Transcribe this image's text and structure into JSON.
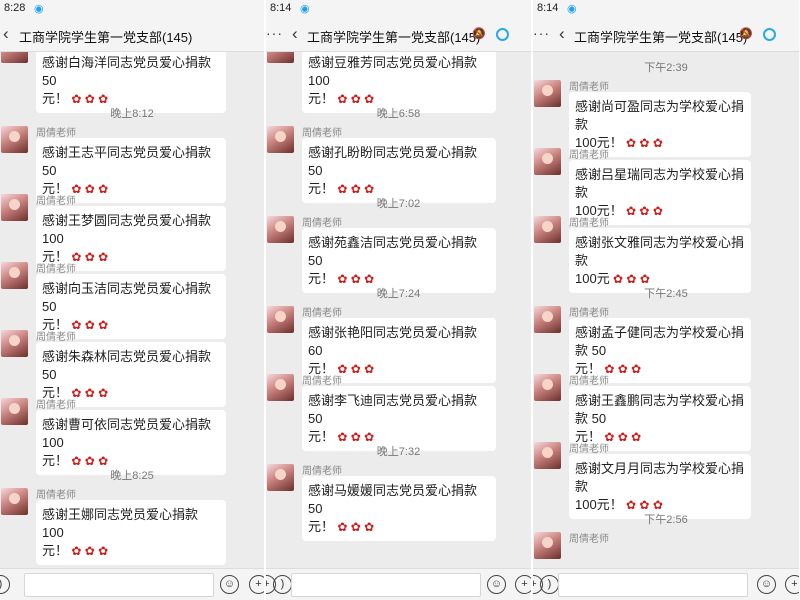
{
  "panels": [
    {
      "status_time": "8:28",
      "title": "工商学院学生第一党支部(145)",
      "show_back": true,
      "show_more": false,
      "show_bell": false,
      "show_ring": false,
      "messages": [
        {
          "kind": "msg",
          "sender": "",
          "lines": [
            "感谢白海洋同志党员爱心捐款 50",
            "元！"
          ]
        },
        {
          "kind": "time",
          "text": "晚上8:12"
        },
        {
          "kind": "msg",
          "sender": "周倩老师",
          "lines": [
            "感谢王志平同志党员爱心捐款 50",
            "元！"
          ]
        },
        {
          "kind": "msg",
          "sender": "周倩老师",
          "lines": [
            "感谢王梦圆同志党员爱心捐款 100",
            "元！"
          ]
        },
        {
          "kind": "msg",
          "sender": "周倩老师",
          "lines": [
            "感谢向玉洁同志党员爱心捐款 50",
            "元！"
          ]
        },
        {
          "kind": "msg",
          "sender": "周倩老师",
          "lines": [
            "感谢朱森林同志党员爱心捐款 50",
            "元！"
          ]
        },
        {
          "kind": "msg",
          "sender": "周倩老师",
          "lines": [
            "感谢曹可依同志党员爱心捐款 100",
            "元！"
          ]
        },
        {
          "kind": "time",
          "text": "晚上8:25"
        },
        {
          "kind": "msg",
          "sender": "周倩老师",
          "lines": [
            "感谢王娜同志党员爱心捐款 100",
            "元！"
          ]
        }
      ]
    },
    {
      "status_time": "8:14",
      "title": "工商学院学生第一党支部(145)",
      "show_back": false,
      "show_more": true,
      "show_bell": true,
      "show_ring": true,
      "messages": [
        {
          "kind": "msg",
          "sender": "",
          "lines": [
            "感谢豆雅芳同志党员爱心捐款 100",
            "元！"
          ]
        },
        {
          "kind": "time",
          "text": "晚上6:58"
        },
        {
          "kind": "msg",
          "sender": "周倩老师",
          "lines": [
            "感谢孔盼盼同志党员爱心捐款 50",
            "元！"
          ]
        },
        {
          "kind": "time",
          "text": "晚上7:02"
        },
        {
          "kind": "msg",
          "sender": "周倩老师",
          "lines": [
            "感谢苑鑫洁同志党员爱心捐款 50",
            "元！"
          ]
        },
        {
          "kind": "time",
          "text": "晚上7:24"
        },
        {
          "kind": "msg",
          "sender": "周倩老师",
          "lines": [
            "感谢张艳阳同志党员爱心捐款 60",
            "元！"
          ]
        },
        {
          "kind": "msg",
          "sender": "周倩老师",
          "lines": [
            "感谢李飞迪同志党员爱心捐款 50",
            "元！"
          ]
        },
        {
          "kind": "time",
          "text": "晚上7:32"
        },
        {
          "kind": "msg",
          "sender": "周倩老师",
          "lines": [
            "感谢马媛媛同志党员爱心捐款 50",
            "元！"
          ]
        }
      ]
    },
    {
      "status_time": "8:14",
      "title": "工商学院学生第一党支部(145)",
      "show_back": false,
      "show_more": true,
      "show_bell": true,
      "show_ring": true,
      "messages": [
        {
          "kind": "time",
          "text": "下午2:39"
        },
        {
          "kind": "msg",
          "sender": "周倩老师",
          "lines": [
            "感谢尚可盈同志为学校爱心捐款",
            "100元！"
          ]
        },
        {
          "kind": "msg",
          "sender": "周倩老师",
          "lines": [
            "感谢吕星瑞同志为学校爱心捐款",
            "100元！"
          ]
        },
        {
          "kind": "msg",
          "sender": "周倩老师",
          "lines": [
            "感谢张文雅同志为学校爱心捐款",
            "100元"
          ]
        },
        {
          "kind": "time",
          "text": "下午2:45"
        },
        {
          "kind": "msg",
          "sender": "周倩老师",
          "lines": [
            "感谢孟子健同志为学校爱心捐款 50",
            "元！"
          ]
        },
        {
          "kind": "msg",
          "sender": "周倩老师",
          "lines": [
            "感谢王鑫鹏同志为学校爱心捐款 50",
            "元！"
          ]
        },
        {
          "kind": "msg",
          "sender": "周倩老师",
          "lines": [
            "感谢文月月同志为学校爱心捐款",
            "100元！"
          ]
        },
        {
          "kind": "time",
          "text": "下午2:56"
        },
        {
          "kind": "msg",
          "sender": "周倩老师",
          "lines": []
        }
      ]
    }
  ],
  "icons": {
    "back": "back-chevron-icon",
    "voice": "voice-icon",
    "emoji": "emoji-icon",
    "plus": "plus-icon"
  },
  "colors": {
    "rose": "#d11a1a",
    "ring": "#2aa8e8",
    "chat_bg": "#ececec"
  }
}
